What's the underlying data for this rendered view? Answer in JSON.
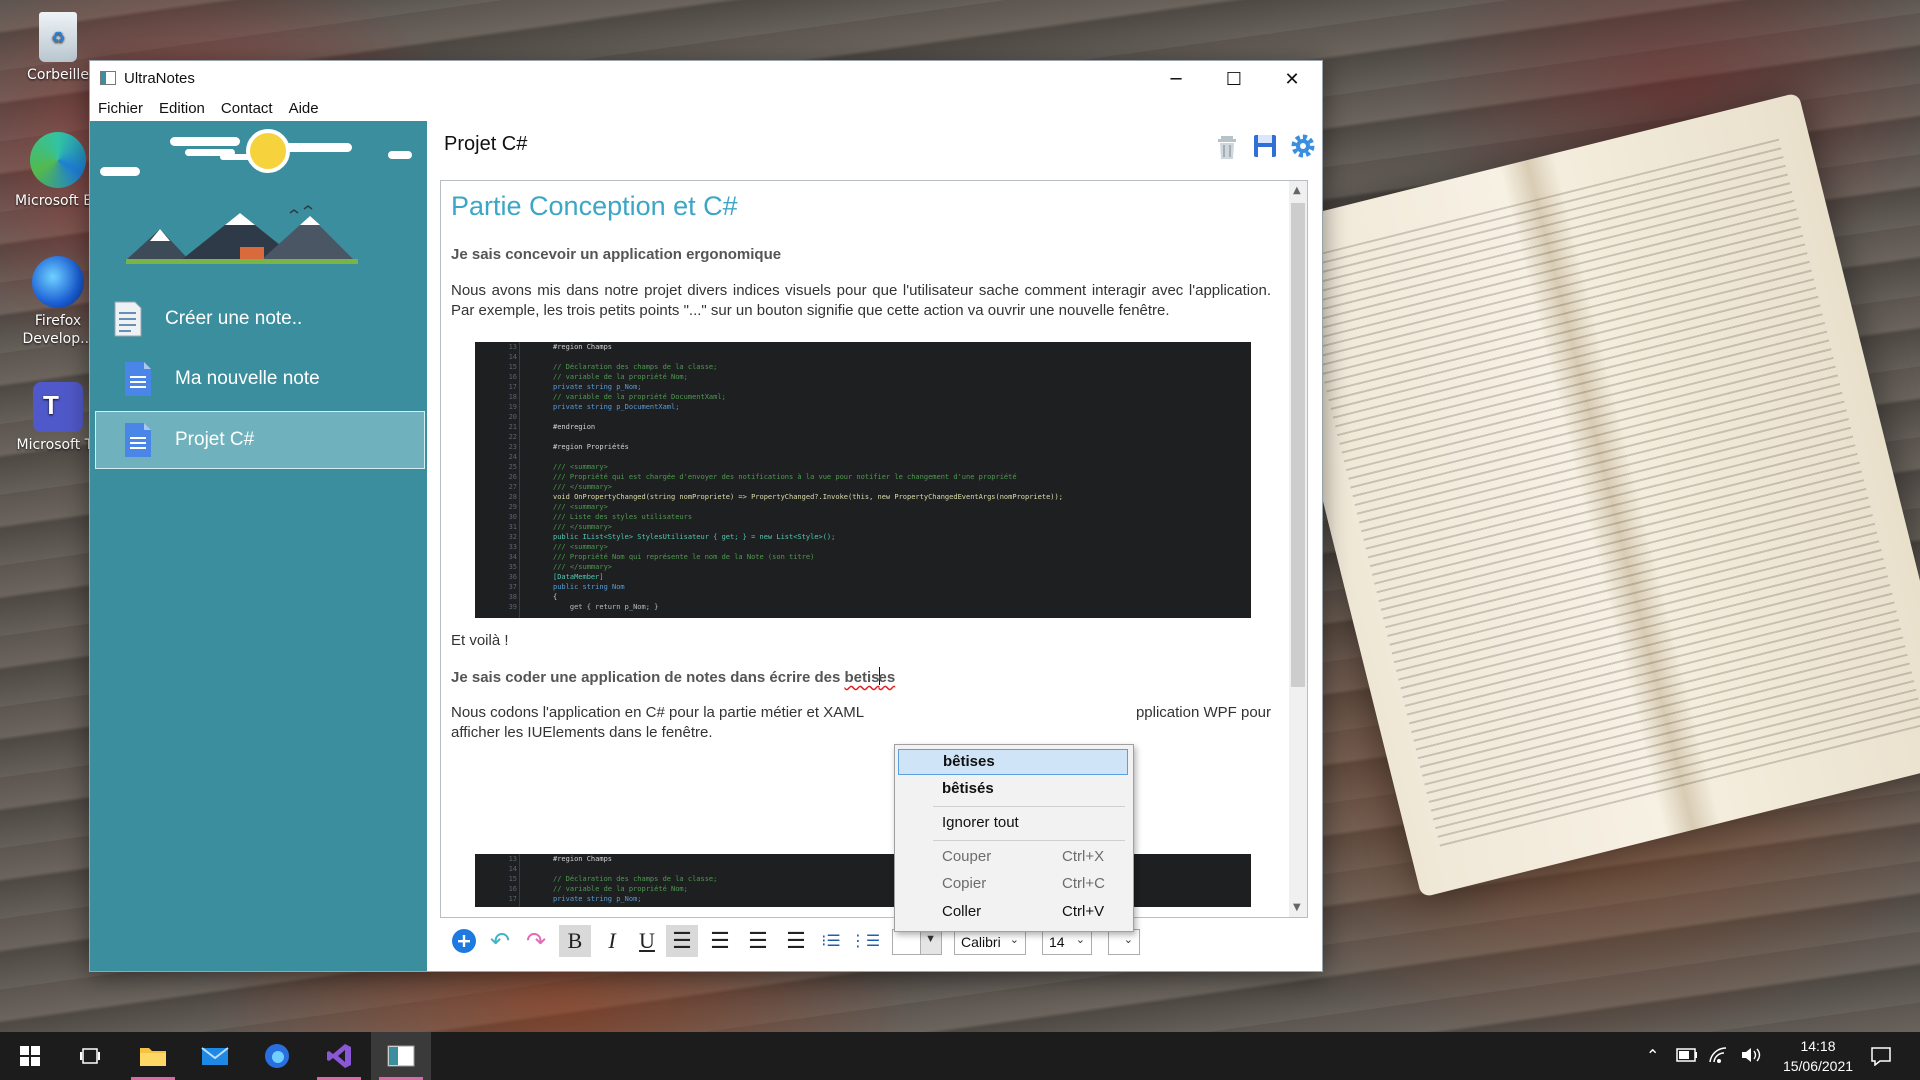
{
  "desktop": {
    "icons": [
      {
        "label": "Corbeille",
        "icon": "recycle-bin-icon"
      },
      {
        "label": "Microsoft Ed",
        "icon": "edge-icon"
      },
      {
        "label": "Firefox\nDevelop...",
        "icon": "firefox-developer-icon"
      },
      {
        "label": "Microsoft Te",
        "icon": "teams-icon"
      }
    ]
  },
  "window": {
    "title": "UltraNotes",
    "controls": {
      "minimize": "─",
      "maximize": "☐",
      "close": "✕"
    }
  },
  "menu": [
    "Fichier",
    "Edition",
    "Contact",
    "Aide"
  ],
  "sidebar": {
    "items": [
      {
        "label": "Créer une note..",
        "icon": "create-note-icon"
      },
      {
        "label": "Ma nouvelle note",
        "icon": "document-icon"
      },
      {
        "label": "Projet C#",
        "icon": "document-icon",
        "selected": true
      }
    ]
  },
  "note": {
    "title": "Projet C#",
    "toolbar_icons": [
      "trash-icon",
      "save-icon",
      "settings-gear-icon"
    ],
    "heading": "Partie Conception et C#",
    "section1_title": "Je sais concevoir un application ergonomique",
    "section1_body": "Nous avons mis dans notre projet divers indices visuels pour que l'utilisateur sache comment interagir avec l'application. Par exemple, les trois petits points \"...\" sur un bouton signifie que cette action va ouvrir une nouvelle fenêtre.",
    "after_code": "Et voilà !",
    "section2_title_prefix": "Je sais coder une application de notes dans écrire des ",
    "section2_misspelled_a": "betis",
    "section2_misspelled_b": "es",
    "section2_body_a": "Nous codons l'application en C# pour la partie métier et XAML",
    "section2_body_b": "pplication WPF pour",
    "section2_body_c": "afficher les IUElements dans le fenêtre."
  },
  "code_block_1": {
    "gutter": [
      "13",
      "14",
      "15",
      "16",
      "17",
      "18",
      "19",
      "20",
      "21",
      "22",
      "23",
      "24",
      "25",
      "26",
      "27",
      "28",
      "29",
      "30",
      "31",
      "32",
      "33",
      "34",
      "35",
      "36",
      "37",
      "38",
      "39"
    ],
    "lines": [
      {
        "c": "",
        "t": "#region Champs"
      },
      {
        "c": "",
        "t": ""
      },
      {
        "c": "c-com",
        "t": "// Déclaration des champs de la classe;"
      },
      {
        "c": "c-com",
        "t": "// variable de la propriété Nom;"
      },
      {
        "c": "c-kw",
        "t": "private string p_Nom;"
      },
      {
        "c": "c-com",
        "t": "// variable de la propriété DocumentXaml;"
      },
      {
        "c": "c-kw",
        "t": "private string p_DocumentXaml;"
      },
      {
        "c": "",
        "t": ""
      },
      {
        "c": "",
        "t": "#endregion"
      },
      {
        "c": "",
        "t": ""
      },
      {
        "c": "",
        "t": "#region Propriétés"
      },
      {
        "c": "",
        "t": ""
      },
      {
        "c": "c-com",
        "t": "/// <summary>"
      },
      {
        "c": "c-com",
        "t": "/// Propriété qui est chargée d'envoyer des notifications à la vue pour notifier le changement d'une propriété"
      },
      {
        "c": "c-com",
        "t": "/// </summary>"
      },
      {
        "c": "c-fn",
        "t": "void OnPropertyChanged(string nomPropriete) => PropertyChanged?.Invoke(this, new PropertyChangedEventArgs(nomPropriete));"
      },
      {
        "c": "c-com",
        "t": "/// <summary>"
      },
      {
        "c": "c-com",
        "t": "/// Liste des styles utilisateurs"
      },
      {
        "c": "c-com",
        "t": "/// </summary>"
      },
      {
        "c": "c-ty",
        "t": "public IList<Style> StylesUtilisateur { get; } = new List<Style>();"
      },
      {
        "c": "c-com",
        "t": "/// <summary>"
      },
      {
        "c": "c-com",
        "t": "/// Propriété Nom qui représente le nom de la Note (son titre)"
      },
      {
        "c": "c-com",
        "t": "/// </summary>"
      },
      {
        "c": "c-ty",
        "t": "[DataMember]"
      },
      {
        "c": "c-kw",
        "t": "public string Nom"
      },
      {
        "c": "",
        "t": "{"
      },
      {
        "c": "c-st",
        "t": "    get { return p_Nom; }"
      }
    ]
  },
  "code_block_2": {
    "gutter": [
      "13",
      "14",
      "15",
      "16",
      "17"
    ],
    "lines": [
      {
        "c": "",
        "t": "#region Champs"
      },
      {
        "c": "",
        "t": ""
      },
      {
        "c": "c-com",
        "t": "// Déclaration des champs de la classe;"
      },
      {
        "c": "c-com",
        "t": "// variable de la propriété Nom;"
      },
      {
        "c": "c-kw",
        "t": "private string p_Nom;"
      }
    ]
  },
  "format_toolbar": {
    "buttons": [
      {
        "name": "add-button",
        "glyph": "+"
      },
      {
        "name": "undo-button",
        "glyph": "↶"
      },
      {
        "name": "redo-button",
        "glyph": "↷"
      },
      {
        "name": "bold-button",
        "glyph": "B"
      },
      {
        "name": "italic-button",
        "glyph": "I"
      },
      {
        "name": "underline-button",
        "glyph": "U"
      },
      {
        "name": "align-left-button",
        "glyph": "☰"
      },
      {
        "name": "align-center-button",
        "glyph": "☰"
      },
      {
        "name": "align-right-button",
        "glyph": "☰"
      },
      {
        "name": "justify-button",
        "glyph": "☰"
      },
      {
        "name": "bullet-list-button",
        "glyph": "⁝☰"
      },
      {
        "name": "numbered-list-button",
        "glyph": "⋮☰"
      }
    ],
    "color_combo": "",
    "font_combo": "Calibri",
    "size_combo": "14",
    "extra_combo": ""
  },
  "context_menu": {
    "suggestions": [
      "bêtises",
      "bêtisés"
    ],
    "ignore": "Ignorer tout",
    "cut": {
      "label": "Couper",
      "shortcut": "Ctrl+X"
    },
    "copy": {
      "label": "Copier",
      "shortcut": "Ctrl+C"
    },
    "paste": {
      "label": "Coller",
      "shortcut": "Ctrl+V"
    }
  },
  "taskbar": {
    "apps": [
      "start-icon",
      "task-view-icon",
      "file-explorer-icon",
      "mail-icon",
      "firefox-icon",
      "visual-studio-icon",
      "ultranotes-icon"
    ],
    "time": "14:18",
    "date": "15/06/2021"
  },
  "colors": {
    "sidebar": "#3b8e9d",
    "heading": "#3ba6c6",
    "accent": "#0078d7"
  }
}
